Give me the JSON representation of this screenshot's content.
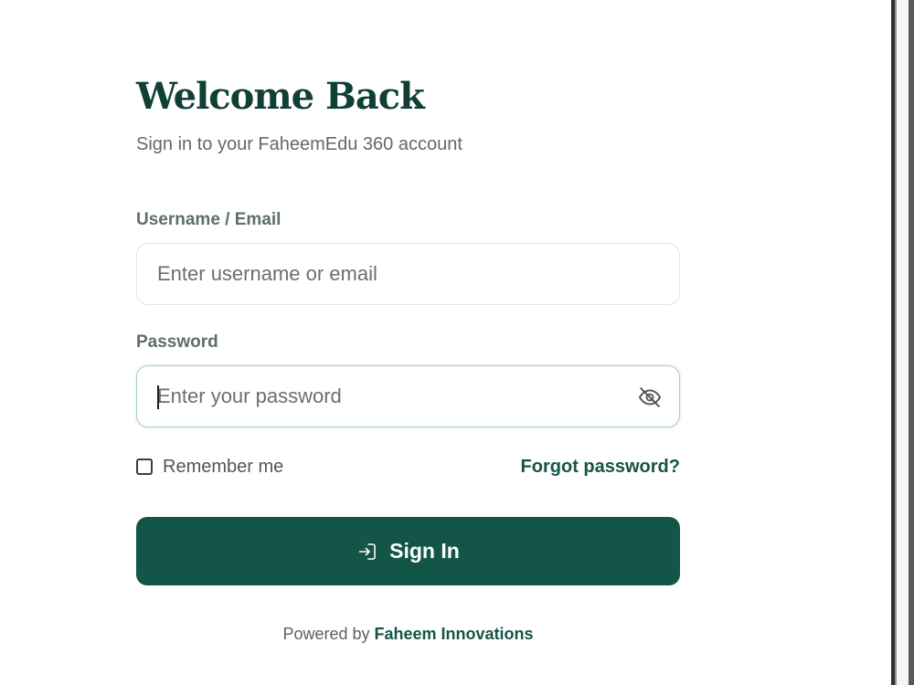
{
  "login": {
    "title": "Welcome Back",
    "subtitle": "Sign in to your FaheemEdu 360 account",
    "username": {
      "label": "Username / Email",
      "placeholder": "Enter username or email",
      "value": ""
    },
    "password": {
      "label": "Password",
      "placeholder": "Enter your password",
      "value": "",
      "toggle_icon": "eye-off-icon"
    },
    "remember_me": {
      "label": "Remember me",
      "checked": false
    },
    "forgot_password": "Forgot password?",
    "submit": {
      "label": "Sign In",
      "icon": "login-icon"
    }
  },
  "footer": {
    "powered_by": "Powered by",
    "company": "Faheem Innovations"
  },
  "colors": {
    "primary": "#135546",
    "title": "#0f3f35",
    "focus_border": "#a8cdbd"
  }
}
